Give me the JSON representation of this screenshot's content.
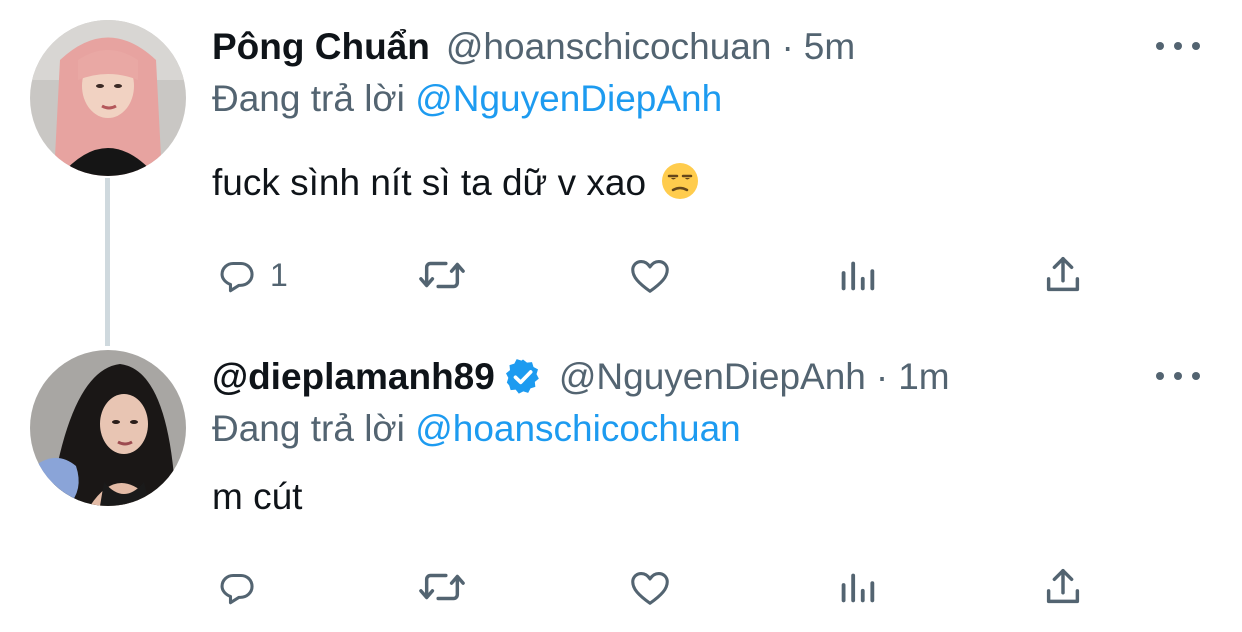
{
  "colors": {
    "text": "#0f1419",
    "secondary": "#536471",
    "link": "#1d9bf0",
    "thread_line": "#cfd9de"
  },
  "tweets": [
    {
      "display_name": "Pông Chuẩn",
      "handle": "@hoanschicochuan",
      "separator": "·",
      "time": "5m",
      "reply_prefix": "Đang trả lời",
      "reply_mention": "@NguyenDiepAnh",
      "text": "fuck sình nít sì ta dữ v xao",
      "emoji": "unamused-face",
      "reply_count": "1",
      "verified": false
    },
    {
      "display_name": "@dieplamanh89",
      "handle": "@NguyenDiepAnh",
      "separator": "·",
      "time": "1m",
      "reply_prefix": "Đang trả lời",
      "reply_mention": "@hoanschicochuan",
      "text": "m cút",
      "reply_count": "",
      "verified": true
    }
  ],
  "icons": {
    "reply": "reply-icon",
    "retweet": "retweet-icon",
    "like": "like-icon",
    "views": "views-icon",
    "share": "share-icon",
    "more": "more-icon",
    "verified": "verified-badge-icon"
  }
}
